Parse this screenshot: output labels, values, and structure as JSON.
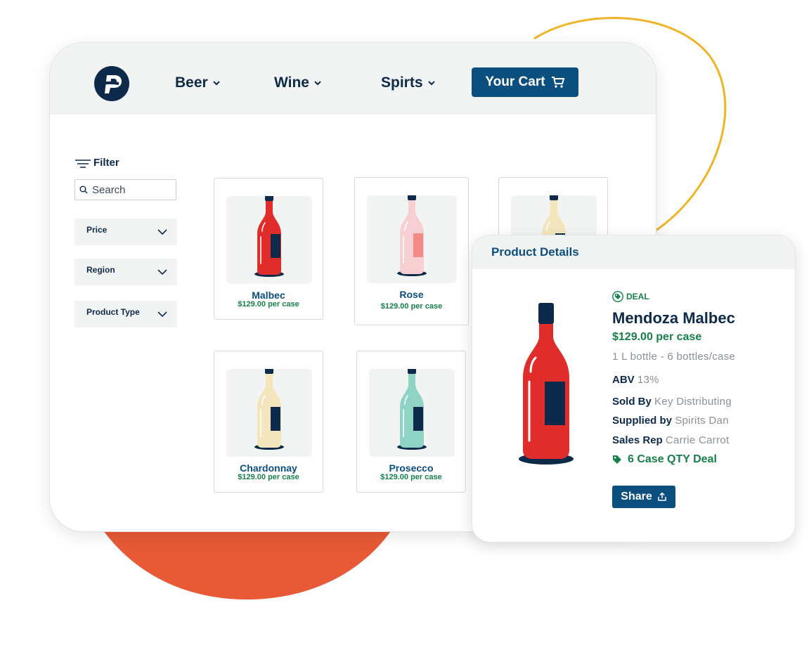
{
  "colors": {
    "navy": "#0d2a4a",
    "accent_blue": "#0b4f7f",
    "deal_green": "#16804a",
    "orange_blob": "#e85a36",
    "yellow_curve": "#f0b429",
    "light_gray": "#f2f4f4"
  },
  "nav": {
    "logo_icon": "p-logo-icon",
    "items": [
      {
        "label": "Beer"
      },
      {
        "label": "Wine"
      },
      {
        "label": "Spirts"
      }
    ],
    "cart_label": "Your Cart",
    "cart_icon": "cart-icon"
  },
  "filter": {
    "title": "Filter",
    "search_placeholder": "Search",
    "search_value": "",
    "dropdowns": [
      {
        "label": "Price"
      },
      {
        "label": "Region"
      },
      {
        "label": "Product Type"
      }
    ]
  },
  "products": [
    {
      "name": "Malbec",
      "price": "$129.00 per case",
      "bottle_color": "#e02d2b",
      "label_color": "#0d2a4a"
    },
    {
      "name": "Rose",
      "price": "$129.00 per case",
      "bottle_color": "#f7cfd2",
      "label_color": "#f28a86"
    },
    {
      "name": "",
      "price": "",
      "bottle_color": "#f3e6bd",
      "label_color": "#0d2a4a"
    },
    {
      "name": "Chardonnay",
      "price": "$129.00 per case",
      "bottle_color": "#f3e6bd",
      "label_color": "#0d2a4a"
    },
    {
      "name": "Prosecco",
      "price": "$129.00 per case",
      "bottle_color": "#8fd3c5",
      "label_color": "#0d2a4a"
    }
  ],
  "details": {
    "header": "Product Details",
    "deal_badge": "DEAL",
    "title": "Mendoza Malbec",
    "price": "$129.00 per case",
    "size": "1 L bottle - 6 bottles/case",
    "abv_label": "ABV",
    "abv_value": "13%",
    "sold_by_label": "Sold By",
    "sold_by_value": "Key Distributing",
    "supplied_by_label": "Supplied by",
    "supplied_by_value": "Spirits Dan",
    "sales_rep_label": "Sales Rep",
    "sales_rep_value": "Carrie Carrot",
    "promo": "6 Case QTY Deal",
    "share_label": "Share"
  }
}
